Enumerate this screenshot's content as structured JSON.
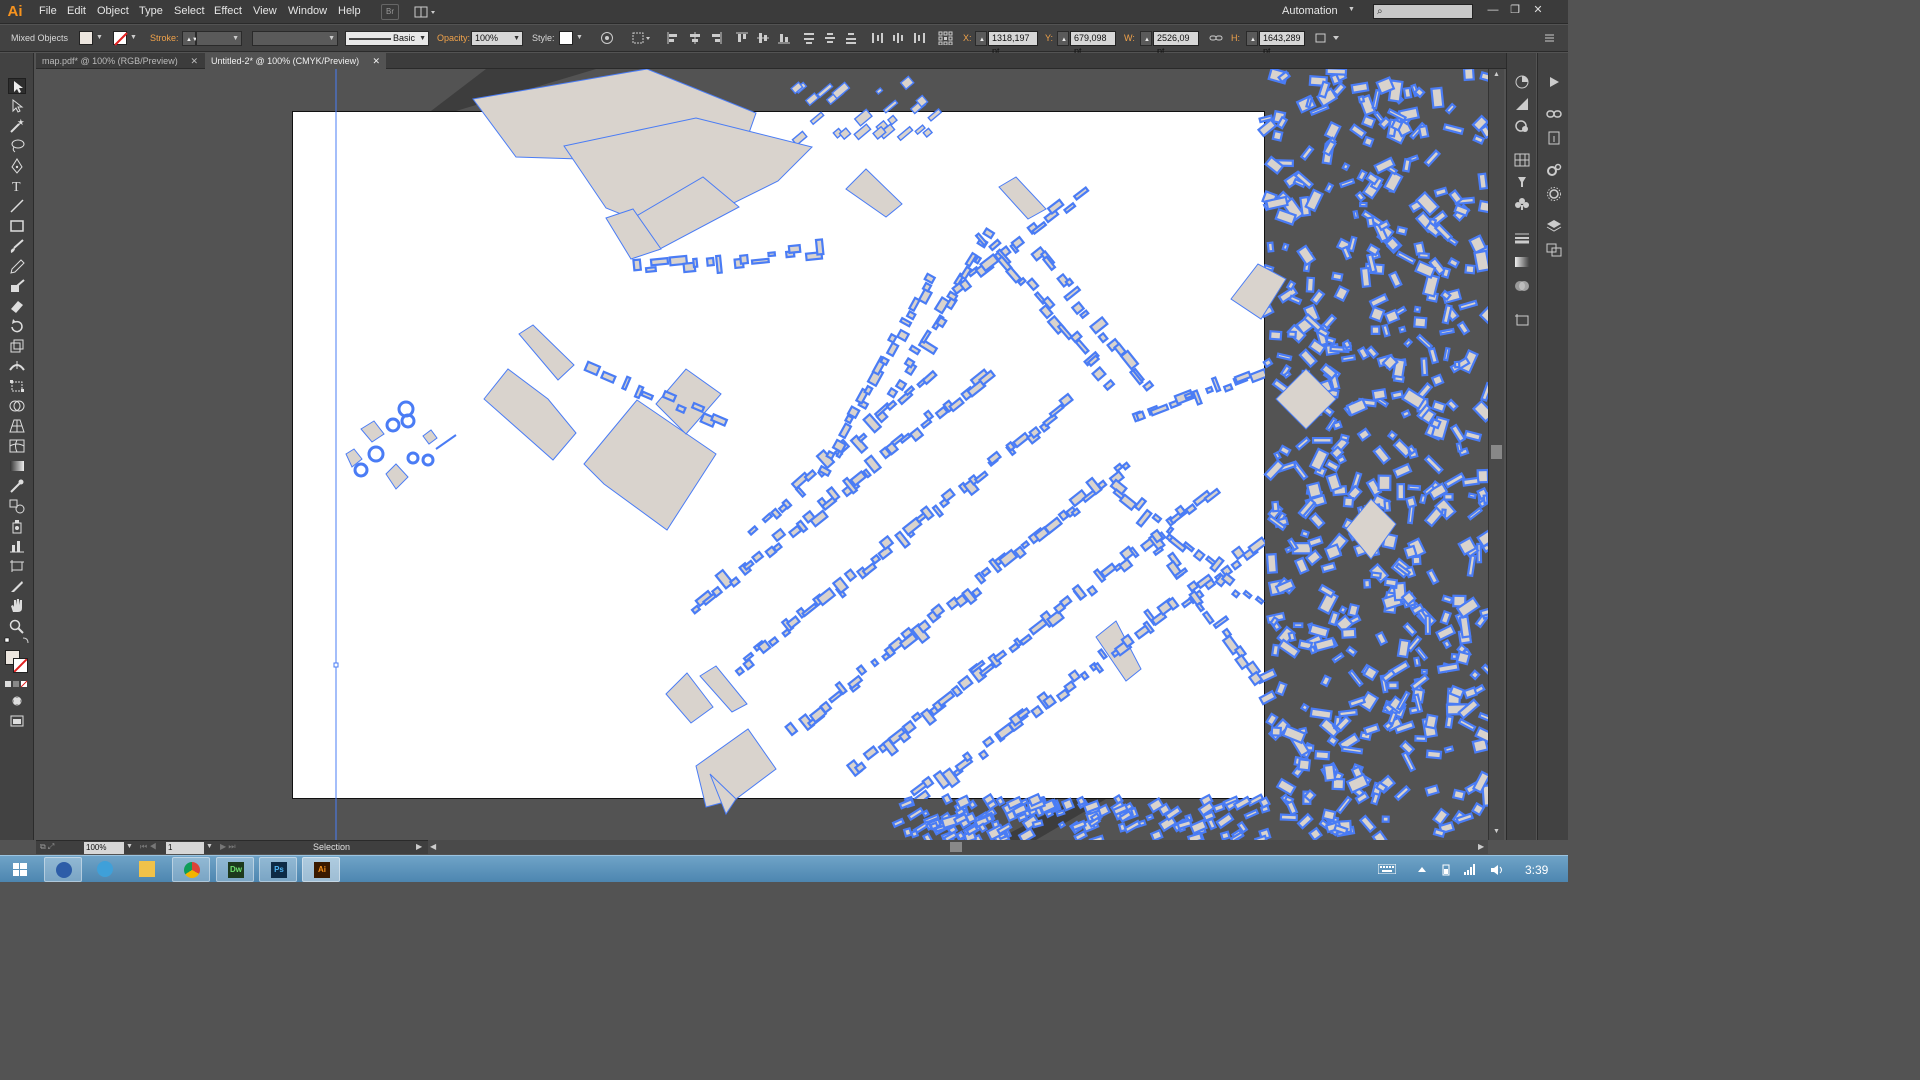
{
  "app": {
    "logo_text": "Ai"
  },
  "menu": {
    "items": [
      {
        "label": "File"
      },
      {
        "label": "Edit"
      },
      {
        "label": "Object"
      },
      {
        "label": "Type"
      },
      {
        "label": "Select"
      },
      {
        "label": "Effect"
      },
      {
        "label": "View"
      },
      {
        "label": "Window"
      },
      {
        "label": "Help"
      }
    ],
    "bridge_label": "Br",
    "workspace": "Automation",
    "search_placeholder": ""
  },
  "control": {
    "selection_type": "Mixed Objects",
    "stroke_label": "Stroke:",
    "brush_label": "Basic",
    "opacity_label": "Opacity:",
    "opacity_value": "100%",
    "style_label": "Style:",
    "x_label": "X:",
    "x_value": "1318,197 pt",
    "y_label": "Y:",
    "y_value": "679,098 pt",
    "w_label": "W:",
    "w_value": "2526,09 pt",
    "h_label": "H:",
    "h_value": "1643,289 pt"
  },
  "tabs": [
    {
      "label": "map.pdf* @ 100% (RGB/Preview)",
      "active": false
    },
    {
      "label": "Untitled-2* @ 100% (CMYK/Preview)",
      "active": true
    }
  ],
  "status": {
    "zoom": "100%",
    "artboard_number": "1",
    "tool_name": "Selection"
  },
  "taskbar": {
    "clock": "3:39",
    "apps": [
      {
        "name": "Thunderbird",
        "abbr": ""
      },
      {
        "name": "Messenger",
        "abbr": ""
      },
      {
        "name": "Explorer",
        "abbr": ""
      },
      {
        "name": "Chrome",
        "abbr": ""
      },
      {
        "name": "Dreamweaver",
        "abbr": "Dw"
      },
      {
        "name": "Photoshop",
        "abbr": "Ps"
      },
      {
        "name": "Illustrator",
        "abbr": "Ai"
      }
    ]
  },
  "colors": {
    "selection_blue": "#4a7cf5",
    "building_fill": "#d9d3cd",
    "artboard": "#ffffff",
    "pasteboard": "#535353",
    "ai_orange": "#f7931e"
  }
}
